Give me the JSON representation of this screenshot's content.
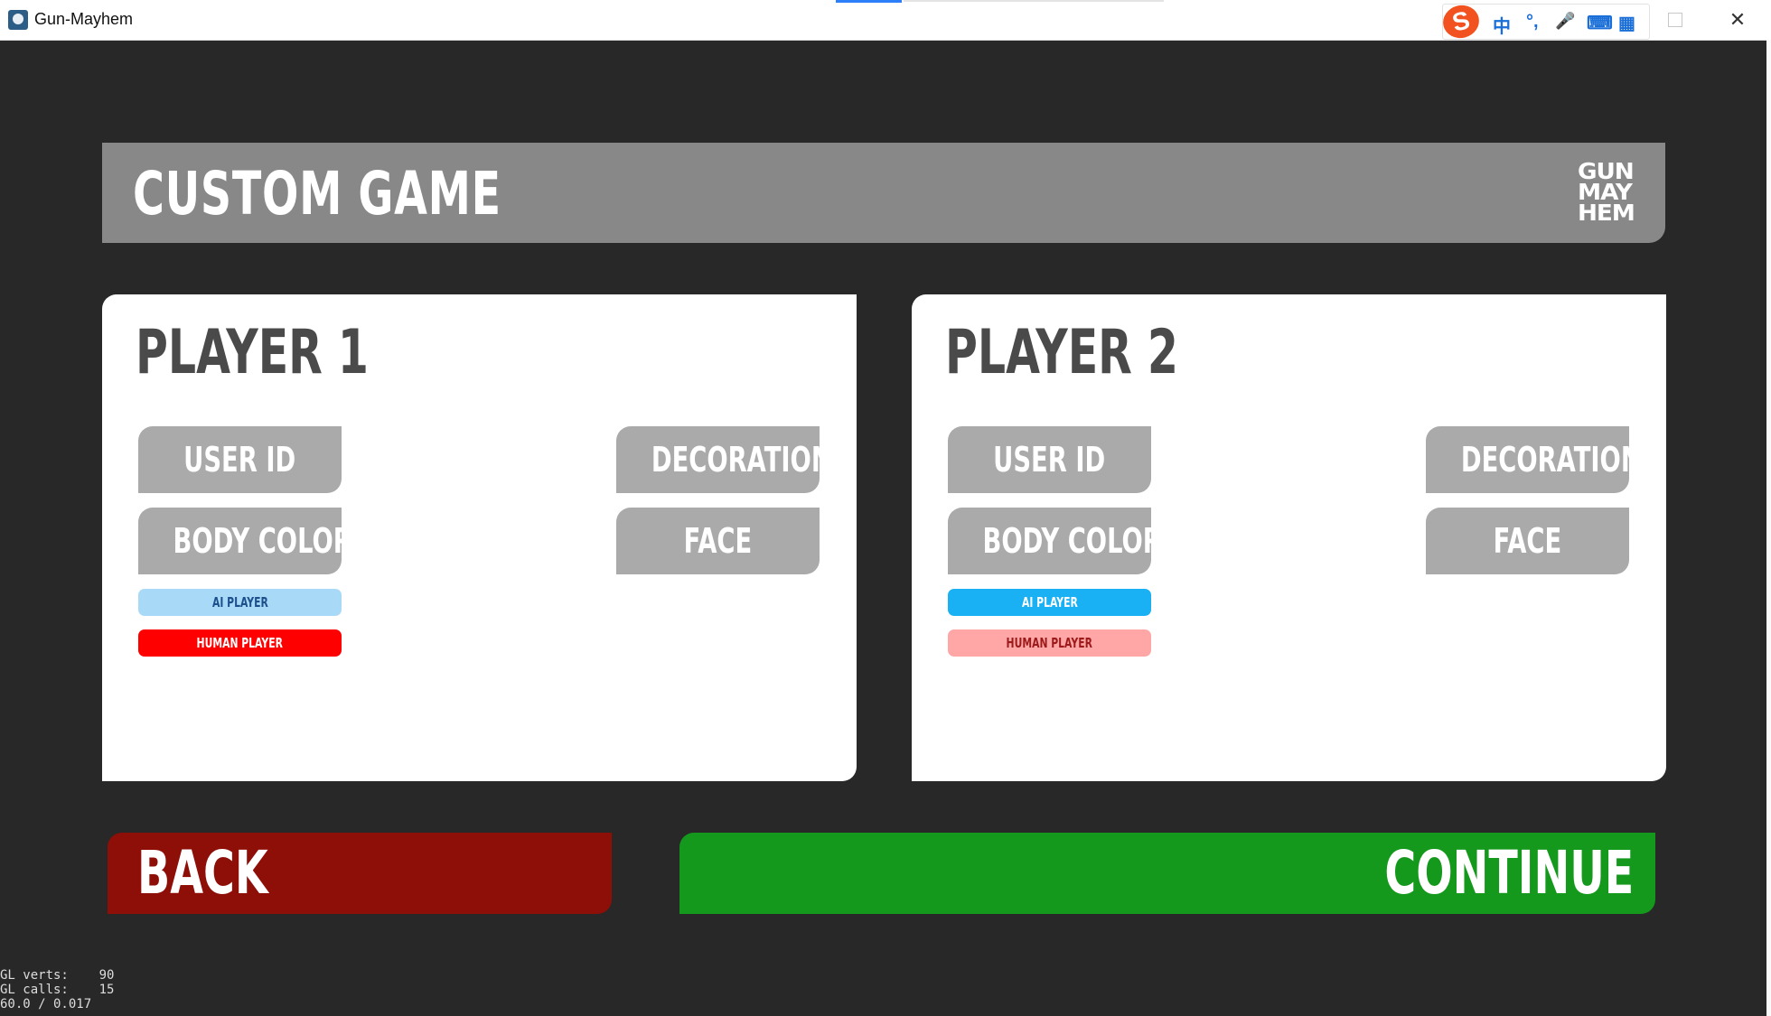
{
  "window": {
    "title": "Gun-Mayhem",
    "close_glyph": "✕"
  },
  "ime": {
    "logo": "S",
    "items": [
      "中",
      "°,",
      "🎤",
      "⌨",
      "▦"
    ]
  },
  "header": {
    "title": "CUSTOM GAME",
    "logo_lines": [
      "GUN",
      "MAY",
      "HEM"
    ]
  },
  "players": [
    {
      "title": "PLAYER 1",
      "user_id": "USER ID",
      "body_color": "BODY COLOR",
      "decoration": "DECORATION",
      "face": "FACE",
      "ai_player": "AI PLAYER",
      "human_player": "HUMAN PLAYER",
      "selected": "human"
    },
    {
      "title": "PLAYER 2",
      "user_id": "USER ID",
      "body_color": "BODY COLOR",
      "decoration": "DECORATION",
      "face": "FACE",
      "ai_player": "AI PLAYER",
      "human_player": "HUMAN PLAYER",
      "selected": "ai"
    }
  ],
  "actions": {
    "back": "BACK",
    "continue": "CONTINUE"
  },
  "debug": {
    "line1": "GL verts:    90",
    "line2": "GL calls:    15",
    "line3": "60.0 / 0.017"
  },
  "colors": {
    "background": "#282828",
    "banner": "#888888",
    "option_button": "#aaaaaa",
    "ai_selected": "#1ab0f4",
    "ai_unselected": "#a8daf8",
    "human_selected": "#ff0000",
    "human_unselected": "#ffa6a6",
    "back": "#8e0e08",
    "continue": "#14991c"
  }
}
